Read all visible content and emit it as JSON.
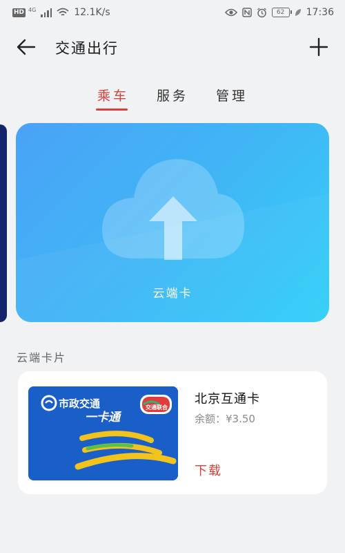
{
  "status_bar": {
    "hd": "HD",
    "network": "4G",
    "speed": "12.1K/s",
    "battery": "62",
    "time": "17:36"
  },
  "header": {
    "title": "交通出行",
    "back_icon": "arrow-left-icon",
    "add_icon": "plus-icon"
  },
  "tabs": [
    {
      "label": "乘车",
      "active": true
    },
    {
      "label": "服务",
      "active": false
    },
    {
      "label": "管理",
      "active": false
    }
  ],
  "carousel": {
    "card_label": "云端卡",
    "icon": "cloud-upload-icon"
  },
  "section": {
    "title": "云端卡片"
  },
  "cards": [
    {
      "name": "北京互通卡",
      "balance": "余额：¥3.50",
      "action": "下载",
      "image_text_1": "市政交通",
      "image_text_2": "一卡通",
      "badge_text": "交通联合"
    }
  ],
  "colors": {
    "accent": "#d8403a",
    "card_gradient_start": "#4aa2f8",
    "card_gradient_end": "#35d0f8",
    "background": "#f1f2f4"
  }
}
